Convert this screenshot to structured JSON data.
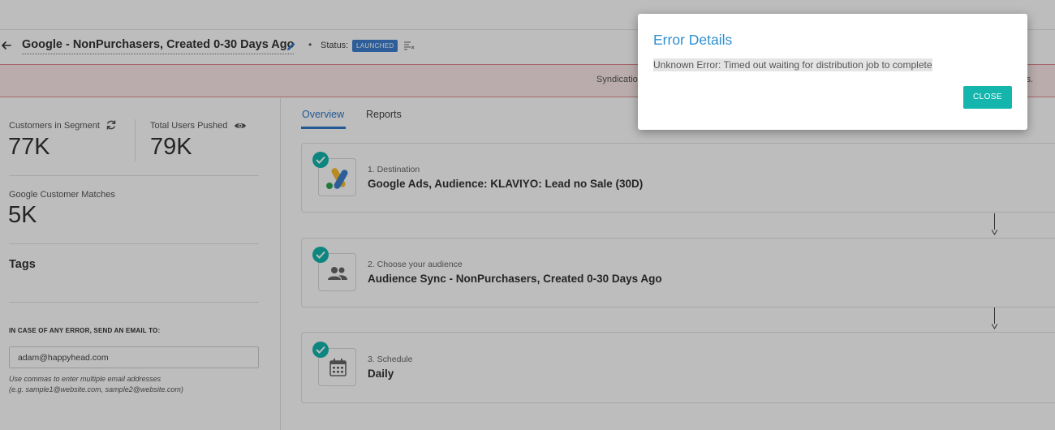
{
  "header": {
    "title": "Google - NonPurchasers, Created 0-30 Days Ago",
    "status_label": "Status:",
    "status_badge": "LAUNCHED",
    "separator": "•"
  },
  "banner": {
    "text": "Syndicatio",
    "tail": "ls."
  },
  "stats": {
    "customers_label": "Customers in Segment",
    "customers_value": "77K",
    "pushed_label": "Total Users Pushed",
    "pushed_value": "79K",
    "matches_label": "Google Customer Matches",
    "matches_value": "5K"
  },
  "tags": {
    "title": "Tags"
  },
  "error_email": {
    "heading": "IN CASE OF ANY ERROR, SEND AN EMAIL TO:",
    "value": "adam@happyhead.com",
    "hint_line1": "Use commas to enter multiple email addresses",
    "hint_line2": "(e.g. sample1@website.com, sample2@website.com)"
  },
  "tabs": [
    {
      "label": "Overview"
    },
    {
      "label": "Reports"
    }
  ],
  "steps": [
    {
      "kicker": "1. Destination",
      "title": "Google Ads, Audience: KLAVIYO: Lead no Sale (30D)",
      "icon": "google-ads-icon"
    },
    {
      "kicker": "2. Choose your audience",
      "title": "Audience Sync - NonPurchasers, Created 0-30 Days Ago",
      "icon": "people-icon"
    },
    {
      "kicker": "3. Schedule",
      "title": "Daily",
      "icon": "calendar-icon"
    }
  ],
  "modal": {
    "title": "Error Details",
    "message": "Unknown Error: Timed out waiting for distribution job to complete",
    "close_label": "CLOSE"
  },
  "colors": {
    "accent_blue": "#2f77c8",
    "teal": "#14b5ad",
    "error_border": "#e08a8f",
    "badge_blue": "#3d7fd0"
  }
}
